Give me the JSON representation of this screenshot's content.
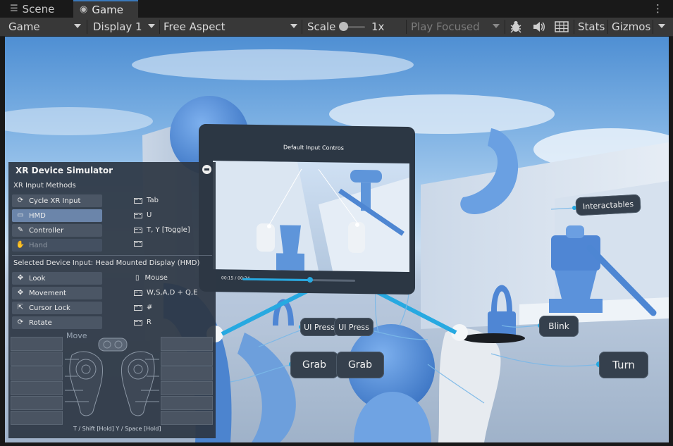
{
  "tabs": {
    "scene_label": "Scene",
    "game_label": "Game",
    "menu_icon": "kebab-menu-icon"
  },
  "toolbar": {
    "mode": "Game",
    "display": "Display 1",
    "aspect": "Free Aspect",
    "scale_label": "Scale",
    "scale_value": "1x",
    "play_focus": "Play Focused",
    "stats": "Stats",
    "gizmos": "Gizmos"
  },
  "scene": {
    "screen_title": "Default Input Contros",
    "time_current": "00:15",
    "time_sep": "/",
    "time_total": "00:24",
    "interactables_label": "Interactables",
    "ui_press_left": "UI Press",
    "ui_press_right": "UI Press",
    "grab_left": "Grab",
    "grab_right": "Grab",
    "blink": "Blink",
    "turn": "Turn",
    "video_progress": 0.6,
    "colors": {
      "panel": "#35404d",
      "accent": "#27a9e1",
      "sky": "#79aee2",
      "object_blue": "#5e95da"
    }
  },
  "simulator": {
    "title": "XR Device Simulator",
    "methods_heading": "XR Input Methods",
    "methods": [
      {
        "label": "Cycle XR Input",
        "key": "Tab",
        "icon": "cycle-icon"
      },
      {
        "label": "HMD",
        "key": "U",
        "icon": "hmd-icon"
      },
      {
        "label": "Controller",
        "key": "T, Y [Toggle]",
        "icon": "controller-icon"
      },
      {
        "label": "Hand",
        "key": "",
        "icon": "hand-icon"
      }
    ],
    "selected_label": "Selected Device Input:",
    "selected_value": "Head Mounted Display (HMD)",
    "controls": [
      {
        "label": "Look",
        "key": "Mouse",
        "icon": "look-icon"
      },
      {
        "label": "Movement",
        "key": "W,S,A,D + Q,E",
        "icon": "move-icon"
      },
      {
        "label": "Cursor Lock",
        "key": "#",
        "icon": "cursor-icon"
      },
      {
        "label": "Rotate",
        "key": "R",
        "icon": "rotate-icon"
      }
    ],
    "move_label": "Move",
    "footer_left": "T / Shift [Hold]",
    "footer_right": "Y / Space [Hold]"
  }
}
